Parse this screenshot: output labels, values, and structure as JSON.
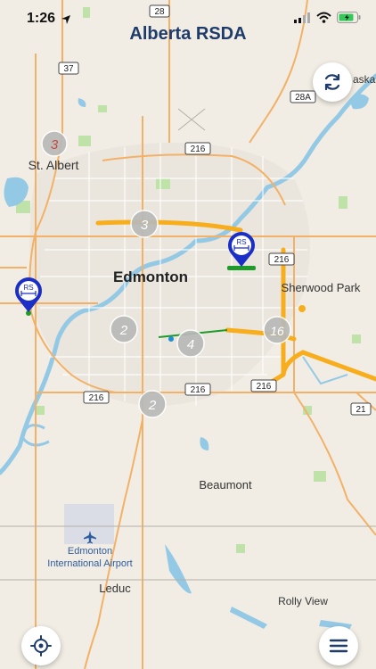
{
  "status_bar": {
    "time": "1:26"
  },
  "header": {
    "title": "Alberta RSDA"
  },
  "places": {
    "st_albert": "St. Albert",
    "edmonton": "Edmonton",
    "sherwood_park": "Sherwood Park",
    "beaumont": "Beaumont",
    "edmonton_airport_1": "Edmonton",
    "edmonton_airport_2": "International Airport",
    "leduc": "Leduc",
    "rolly_view": "Rolly View",
    "partial_top_right": "aska"
  },
  "highway_shields": {
    "h28": "28",
    "h37": "37",
    "h28a": "28A",
    "h216_north": "216",
    "h216_east": "216",
    "h216_sw": "216",
    "h216_s": "216",
    "h216_se": "216",
    "h21": "21"
  },
  "clusters": {
    "c_st_albert": "3",
    "c_north": "3",
    "c_south_west": "2",
    "c_south_centre": "4",
    "c_east": "16",
    "c_south": "2"
  },
  "markers": {
    "rs_east": "RS",
    "rs_west": "RS"
  },
  "colors": {
    "land": "#f1ede4",
    "water": "#94c9e6",
    "freeway": "#f8ad1c",
    "arterial": "#f3b168",
    "park": "#bfe2a8",
    "marker": "#1b2fc6",
    "marker_base": "#1e9c2a",
    "title": "#1e3b6a",
    "cluster": "#b9b9b9"
  },
  "icons": {
    "refresh": "refresh-icon",
    "locate": "crosshair-icon",
    "menu": "menu-icon",
    "airport": "airplane-icon"
  }
}
